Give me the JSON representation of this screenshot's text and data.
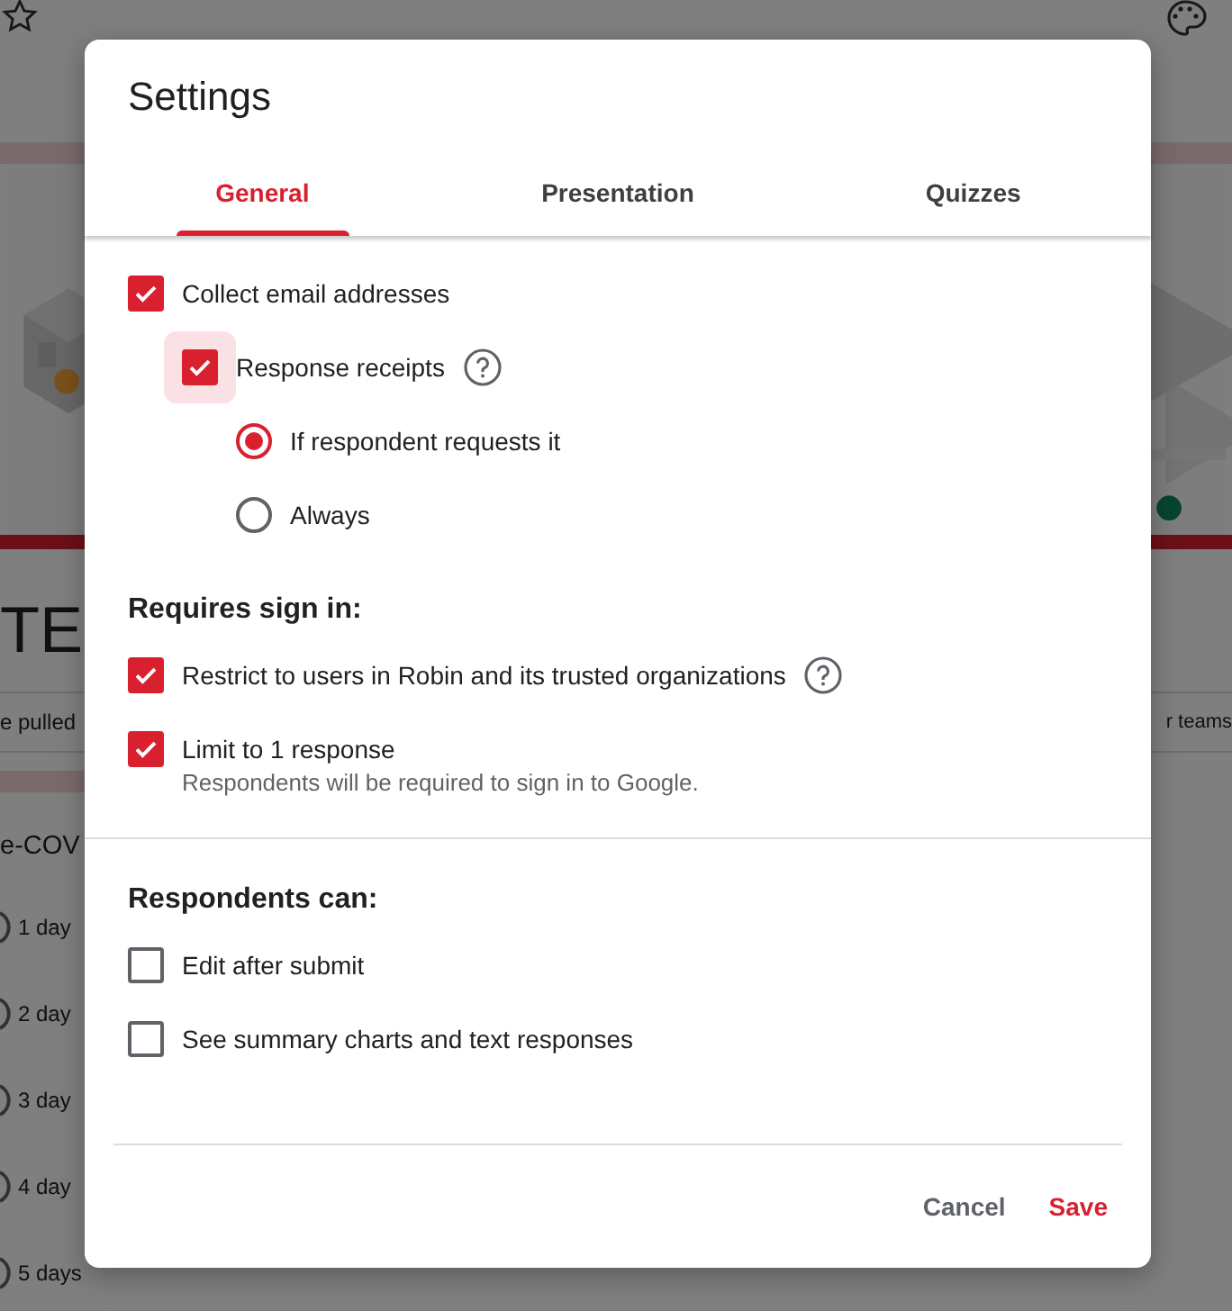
{
  "background": {
    "header_title": "TE",
    "description_left": "e pulled",
    "description_right": "r teams",
    "question": "e-COV",
    "options": [
      {
        "label": "1 day",
        "selected": false
      },
      {
        "label": "2 day",
        "selected": false
      },
      {
        "label": "3 day",
        "selected": false
      },
      {
        "label": "4 day",
        "selected": false
      },
      {
        "label": "5 days",
        "selected": false
      }
    ]
  },
  "dialog": {
    "title": "Settings",
    "tabs": [
      {
        "label": "General",
        "selected": true
      },
      {
        "label": "Presentation",
        "selected": false
      },
      {
        "label": "Quizzes",
        "selected": false
      }
    ],
    "sections": [
      {
        "items": [
          {
            "kind": "checkbox",
            "label": "Collect email addresses",
            "checked": true,
            "children": [
              {
                "kind": "checkbox",
                "label": "Response receipts",
                "checked": true,
                "focused": true,
                "help": true,
                "children": [
                  {
                    "kind": "radio",
                    "label": "If respondent requests it",
                    "selected": true
                  },
                  {
                    "kind": "radio",
                    "label": "Always",
                    "selected": false
                  }
                ]
              }
            ]
          }
        ]
      },
      {
        "heading": "Requires sign in:",
        "divider_after": true,
        "items": [
          {
            "kind": "checkbox",
            "label": "Restrict to users in Robin and its trusted organizations",
            "checked": true,
            "help": true
          },
          {
            "kind": "checkbox",
            "label": "Limit to 1 response",
            "checked": true,
            "note": "Respondents will be required to sign in to Google."
          }
        ]
      },
      {
        "heading": "Respondents can:",
        "items": [
          {
            "kind": "checkbox",
            "label": "Edit after submit",
            "checked": false
          },
          {
            "kind": "checkbox",
            "label": "See summary charts and text responses",
            "checked": false
          }
        ]
      }
    ],
    "buttons": [
      {
        "label": "Cancel",
        "kind": "secondary"
      },
      {
        "label": "Save",
        "kind": "primary"
      }
    ]
  }
}
